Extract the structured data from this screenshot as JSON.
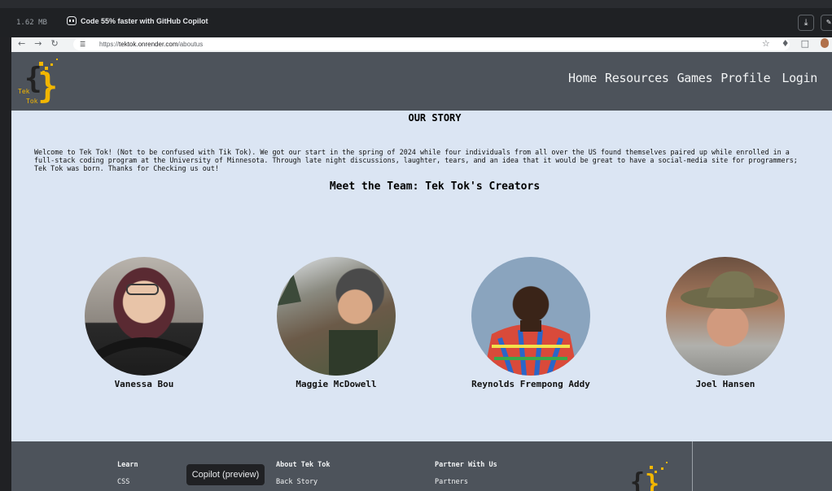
{
  "topbar": {
    "size": "1.62 MB",
    "copilot_promo": "Code 55% faster with GitHub Copilot"
  },
  "browser": {
    "url_scheme": "https://",
    "url_host": "tektok.onrender.com",
    "url_path": "/aboutus"
  },
  "header": {
    "logo_text_top": "Tek",
    "logo_text_bottom": "Tok",
    "nav": [
      "Home",
      "Resources",
      "Games",
      "Profile",
      "Login"
    ]
  },
  "main": {
    "story_title": "OUR STORY",
    "story_text": "Welcome to Tek Tok! (Not to be confused with Tik Tok). We got our start in the spring of 2024 while four individuals from all over the US found themselves paired up while enrolled in a\nfull-stack coding program at the University of Minnesota. Through late night discussions, laughter, tears, and an idea that it would be great to have a social-media site for programmers;\nTek Tok was born. Thanks for Checking us out!",
    "team_title": "Meet the Team: Tek Tok's Creators",
    "members": [
      {
        "name": "Vanessa Bou"
      },
      {
        "name": "Maggie McDowell"
      },
      {
        "name": "Reynolds Frempong Addy"
      },
      {
        "name": "Joel Hansen"
      }
    ]
  },
  "footer": {
    "learn": {
      "heading": "Learn",
      "links": [
        "CSS"
      ]
    },
    "about": {
      "heading": "About Tek Tok",
      "links": [
        "Back Story"
      ]
    },
    "partner": {
      "heading": "Partner With Us",
      "links": [
        "Partners"
      ]
    }
  },
  "tooltip": "Copilot (preview)",
  "colors": {
    "header_bg": "#4d535b",
    "main_bg": "#dbe5f3",
    "logo_gold": "#f2b600"
  }
}
